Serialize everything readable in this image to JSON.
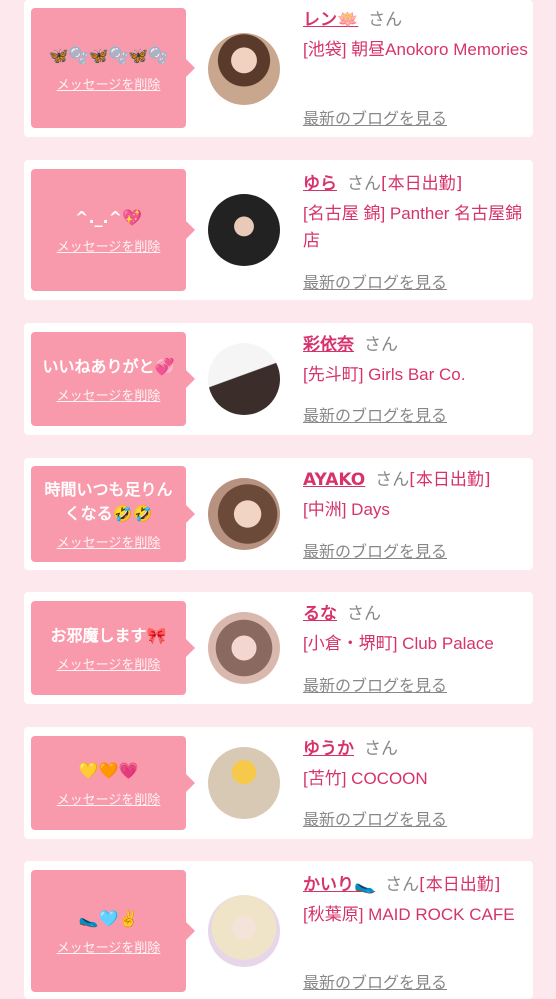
{
  "common": {
    "delete_label": "メッセージを削除",
    "san": "さん",
    "blog_label": "最新のブログを見る"
  },
  "colors": {
    "background": "#fde8ee",
    "card": "#ffffff",
    "bubble": "#f89aab",
    "name": "#d6336c",
    "link_gray": "#888888"
  },
  "cards": [
    {
      "message": "🦋🫧🦋🫧🦋🫧",
      "name": "レン🪷",
      "status": "",
      "shop": "[池袋] 朝昼Anokoro Memories"
    },
    {
      "message": "^._.^💖",
      "name": "ゆら",
      "status": "[本日出勤]",
      "shop": "[名古屋 錦] Panther 名古屋錦店"
    },
    {
      "message": "いいねありがと💞",
      "name": "彩依奈",
      "status": "",
      "shop": "[先斗町] Girls Bar Co."
    },
    {
      "message": "時間いつも足りんくなる🤣🤣",
      "name": "AYAKO",
      "status": "[本日出勤]",
      "shop": "[中洲] Days"
    },
    {
      "message": "お邪魔します🎀",
      "name": "るな",
      "status": "",
      "shop": "[小倉・堺町] Club Palace"
    },
    {
      "message": "💛🧡💗",
      "name": "ゆうか",
      "status": "",
      "shop": "[苫竹] COCOON"
    },
    {
      "message": "🥿🩵✌️",
      "name": "かいり🥿",
      "status": "[本日出勤]",
      "shop": "[秋葉原] MAID ROCK CAFE"
    }
  ]
}
